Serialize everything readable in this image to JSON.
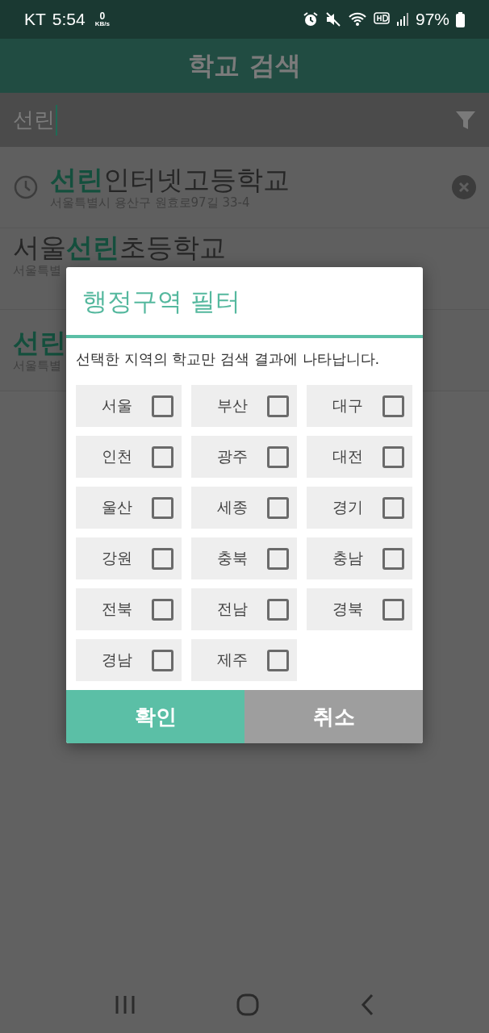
{
  "status_bar": {
    "carrier": "KT",
    "time": "5:54",
    "speed_value": "0",
    "speed_unit": "KB/s",
    "battery": "97%"
  },
  "app_bar": {
    "title": "학교 검색"
  },
  "search": {
    "value": "선린"
  },
  "results": [
    {
      "recent": true,
      "parts": [
        {
          "text": "선린",
          "match": true
        },
        {
          "text": "인터넷고등학교",
          "match": false
        }
      ],
      "address": "서울특별시 용산구 원효로97길 33-4"
    },
    {
      "recent": false,
      "parts": [
        {
          "text": "서울",
          "match": false
        },
        {
          "text": "선린",
          "match": true
        },
        {
          "text": "초등학교",
          "match": false
        }
      ],
      "address": "서울특별"
    },
    {
      "recent": false,
      "parts": [
        {
          "text": "선린",
          "match": true
        }
      ],
      "address": "서울특별"
    }
  ],
  "dialog": {
    "title": "행정구역 필터",
    "message": "선택한 지역의 학교만 검색 결과에 나타납니다.",
    "regions": [
      {
        "label": "서울",
        "checked": false
      },
      {
        "label": "부산",
        "checked": false
      },
      {
        "label": "대구",
        "checked": false
      },
      {
        "label": "인천",
        "checked": false
      },
      {
        "label": "광주",
        "checked": false
      },
      {
        "label": "대전",
        "checked": false
      },
      {
        "label": "울산",
        "checked": false
      },
      {
        "label": "세종",
        "checked": false
      },
      {
        "label": "경기",
        "checked": false
      },
      {
        "label": "강원",
        "checked": false
      },
      {
        "label": "충북",
        "checked": false
      },
      {
        "label": "충남",
        "checked": false
      },
      {
        "label": "전북",
        "checked": false
      },
      {
        "label": "전남",
        "checked": false
      },
      {
        "label": "경북",
        "checked": false
      },
      {
        "label": "경남",
        "checked": false
      },
      {
        "label": "제주",
        "checked": false
      }
    ],
    "buttons": [
      {
        "label": "확인",
        "kind": "confirm"
      },
      {
        "label": "취소",
        "kind": "cancel"
      }
    ]
  }
}
